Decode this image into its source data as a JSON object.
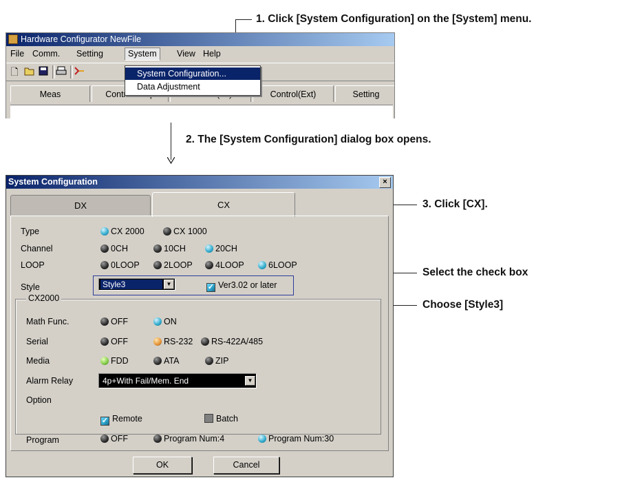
{
  "callouts": {
    "step1": "1. Click [System Configuration] on the [System] menu.",
    "step2": "2. The [System Configuration] dialog box opens.",
    "step3": "3. Click [CX].",
    "select_check": "Select the check box",
    "choose_style": "Choose [Style3]"
  },
  "app": {
    "title": "Hardware Configurator NewFile",
    "menu": [
      "File",
      "Comm.",
      "Setting",
      "System",
      "View",
      "Help"
    ],
    "dropdown": [
      "System Configuration...",
      "Data Adjustment"
    ],
    "tabs": [
      "Meas",
      "Control Loop",
      "Control(Int)",
      "Control(Ext)",
      "Setting"
    ],
    "toolbar_icons": [
      "new-icon",
      "open-icon",
      "save-icon",
      "print-icon",
      "transfer-icon"
    ]
  },
  "dialog": {
    "title": "System Configuration",
    "close": "×",
    "tabs": [
      "DX",
      "CX"
    ],
    "type": {
      "label": "Type",
      "options": [
        "CX 2000",
        "CX 1000"
      ],
      "selected": 0
    },
    "channel": {
      "label": "Channel",
      "options": [
        "0CH",
        "10CH",
        "20CH"
      ],
      "selected": 2
    },
    "loop": {
      "label": "LOOP",
      "options": [
        "0LOOP",
        "2LOOP",
        "4LOOP",
        "6LOOP"
      ],
      "selected": 3
    },
    "style": {
      "label": "Style",
      "value": "Style3",
      "checkbox_label": "Ver3.02 or later",
      "checkbox_checked": true
    },
    "group_label": "CX2000",
    "math": {
      "label": "Math Func.",
      "options": [
        "OFF",
        "ON"
      ],
      "selected": 1
    },
    "serial": {
      "label": "Serial",
      "options": [
        "OFF",
        "RS-232",
        "RS-422A/485"
      ],
      "selected": 1
    },
    "media": {
      "label": "Media",
      "options": [
        "FDD",
        "ATA",
        "ZIP"
      ],
      "selected": 0
    },
    "alarm": {
      "label": "Alarm Relay",
      "value": "4p+With Fail/Mem. End"
    },
    "option": {
      "label": "Option",
      "remote": "Remote",
      "remote_checked": true,
      "batch": "Batch",
      "batch_checked": false
    },
    "program": {
      "label": "Program",
      "options": [
        "OFF",
        "Program Num:4",
        "Program Num:30"
      ],
      "selected": 2
    },
    "ok": "OK",
    "cancel": "Cancel"
  },
  "colors": {
    "titlebar": "#0a246a",
    "face": "#d4d0c8",
    "highlight_box": "#2a3a9a"
  }
}
